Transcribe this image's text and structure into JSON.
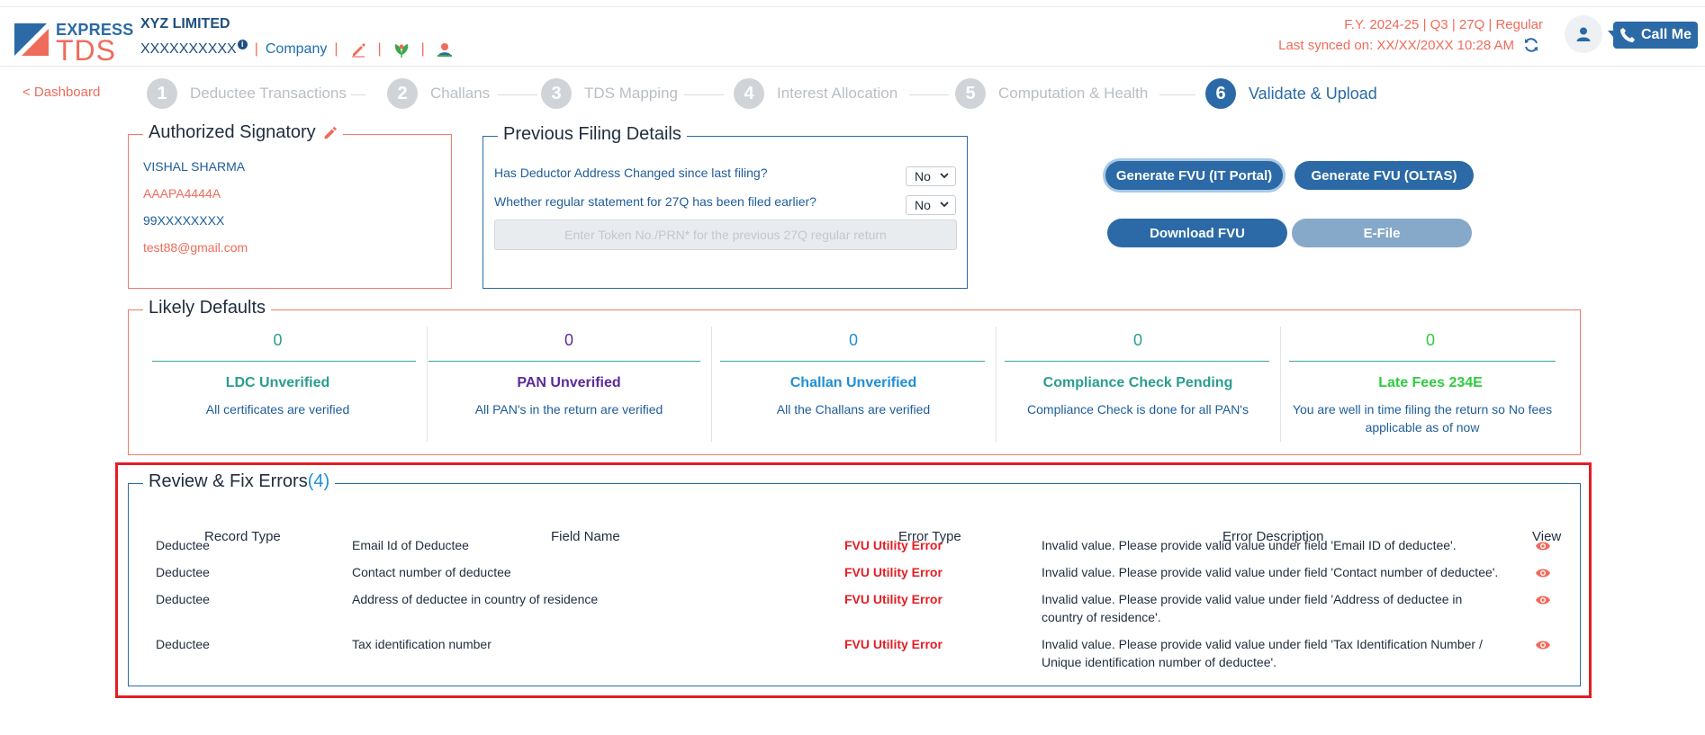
{
  "header": {
    "logo_top": "EXPRESS",
    "logo_bottom": "TDS",
    "company_name": "XYZ LIMITED",
    "pan": "XXXXXXXXXX",
    "company_label": "Company",
    "fy_line": "F.Y. 2024-25  | Q3  | 27Q | Regular",
    "synced_line": "Last synced on: XX/XX/20XX 10:28 AM",
    "call_me": "Call Me"
  },
  "nav": {
    "dashboard_link": "< Dashboard",
    "steps": [
      {
        "num": "1",
        "label": "Deductee Transactions"
      },
      {
        "num": "2",
        "label": "Challans"
      },
      {
        "num": "3",
        "label": "TDS Mapping"
      },
      {
        "num": "4",
        "label": "Interest Allocation"
      },
      {
        "num": "5",
        "label": "Computation & Health"
      },
      {
        "num": "6",
        "label": "Validate & Upload"
      }
    ],
    "active_step": 6
  },
  "signatory": {
    "title": "Authorized Signatory",
    "name": "VISHAL SHARMA",
    "pan": "AAAPA4444A",
    "phone": "99XXXXXXXX",
    "email": "test88@gmail.com"
  },
  "previous_filing": {
    "title": "Previous Filing Details",
    "q1": "Has Deductor Address Changed since last filing?",
    "q1_value": "No",
    "q2": "Whether regular statement for 27Q has been filed earlier?",
    "q2_value": "No",
    "token_placeholder": "Enter Token No./PRN* for the previous 27Q regular return"
  },
  "actions": {
    "generate_it": "Generate FVU (IT Portal)",
    "generate_oltas": "Generate FVU (OLTAS)",
    "download": "Download FVU",
    "efile": "E-File"
  },
  "likely_defaults": {
    "title": "Likely Defaults",
    "items": [
      {
        "value": "0",
        "title": "LDC Unverified",
        "desc": "All certificates are verified",
        "color": "#2a9d8f"
      },
      {
        "value": "0",
        "title": "PAN Unverified",
        "desc": "All PAN's in the return are verified",
        "color": "#5b2a9a"
      },
      {
        "value": "0",
        "title": "Challan Unverified",
        "desc": "All the Challans are verified",
        "color": "#1f8fd6"
      },
      {
        "value": "0",
        "title": "Compliance Check Pending",
        "desc": "Compliance Check is done for all PAN's",
        "color": "#2a9d8f"
      },
      {
        "value": "0",
        "title": "Late Fees 234E",
        "desc": "You are well in time filing the return so No fees applicable as of now",
        "color": "#2ecc40"
      }
    ]
  },
  "errors": {
    "title": "Review & Fix Errors",
    "count": "(4)",
    "columns": [
      "Record Type",
      "Field Name",
      "Error Type",
      "Error Description",
      "View"
    ],
    "rows": [
      {
        "record": "Deductee",
        "field": "Email Id of Deductee",
        "type": "FVU Utility Error",
        "desc": "Invalid value. Please provide valid value under field 'Email ID of deductee'."
      },
      {
        "record": "Deductee",
        "field": "Contact number of deductee",
        "type": "FVU Utility Error",
        "desc": "Invalid value. Please provide valid value under field 'Contact number of deductee'."
      },
      {
        "record": "Deductee",
        "field": "Address of deductee in country of residence",
        "type": "FVU Utility Error",
        "desc": "Invalid value. Please provide valid value under field 'Address of deductee in country of residence'."
      },
      {
        "record": "Deductee",
        "field": "Tax identification number",
        "type": "FVU Utility Error",
        "desc": "Invalid value. Please provide valid value under field 'Tax Identification Number / Unique identification number of deductee'."
      }
    ]
  },
  "colors": {
    "brand_blue": "#2b6aa6",
    "accent_coral": "#ef6b5b",
    "error_red": "#e31e24"
  },
  "icons": [
    "express-tds-logo",
    "info-icon",
    "pencil-icon",
    "leaf-icon",
    "user-badge-icon",
    "sync-icon",
    "user-icon",
    "phone-icon",
    "chevron-down-icon",
    "eye-icon"
  ]
}
